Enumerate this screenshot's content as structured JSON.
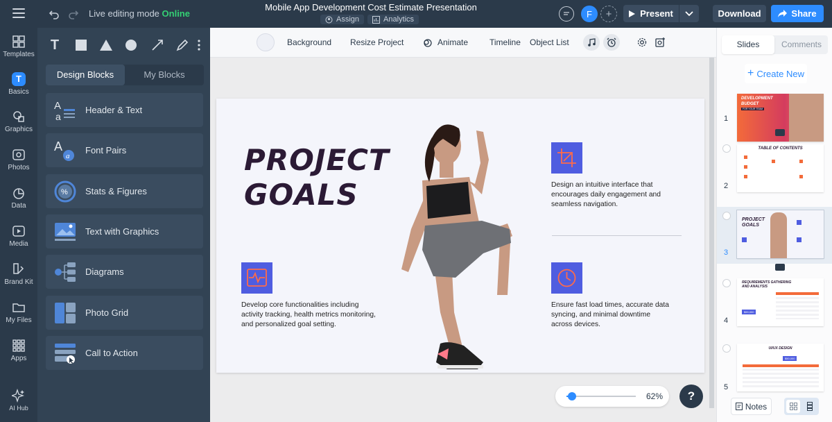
{
  "header": {
    "mode_label": "Live editing mode",
    "mode_status": "Online",
    "doc_title": "Mobile App Development Cost Estimate Presentation",
    "assign_label": "Assign",
    "analytics_label": "Analytics",
    "avatar_initial": "F",
    "present_label": "Present",
    "download_label": "Download",
    "share_label": "Share"
  },
  "rail": {
    "items": [
      {
        "label": "Templates",
        "icon": "templates-icon"
      },
      {
        "label": "Basics",
        "icon": "basics-icon"
      },
      {
        "label": "Graphics",
        "icon": "graphics-icon"
      },
      {
        "label": "Photos",
        "icon": "photos-icon"
      },
      {
        "label": "Data",
        "icon": "data-icon"
      },
      {
        "label": "Media",
        "icon": "media-icon"
      },
      {
        "label": "Brand Kit",
        "icon": "brand-kit-icon"
      },
      {
        "label": "My Files",
        "icon": "folder-icon"
      },
      {
        "label": "Apps",
        "icon": "apps-icon"
      },
      {
        "label": "AI Hub",
        "icon": "ai-sparkle-icon"
      }
    ],
    "active": "Basics"
  },
  "panel": {
    "tabs": [
      "Design Blocks",
      "My Blocks"
    ],
    "blocks": [
      "Header & Text",
      "Font Pairs",
      "Stats & Figures",
      "Text with Graphics",
      "Diagrams",
      "Photo Grid",
      "Call to Action"
    ]
  },
  "toolbar": {
    "background": "Background",
    "resize": "Resize Project",
    "animate": "Animate",
    "timeline": "Timeline",
    "object_list": "Object List"
  },
  "slide": {
    "title_line1": "PROJECT",
    "title_line2": "GOALS",
    "feature1": "Design an intuitive interface that encourages daily engagement and seamless navigation.",
    "feature2": "Develop core functionalities including activity tracking, health metrics monitoring, and personalized goal setting.",
    "feature3": "Ensure fast load times, accurate data syncing, and minimal downtime across devices."
  },
  "zoom": {
    "value": "62%",
    "level": 0.08
  },
  "right_panel": {
    "tabs": [
      "Slides",
      "Comments"
    ],
    "create_label": "Create New",
    "thumbs": [
      {
        "num": "1",
        "title": "DEVELOPMENT BUDGET",
        "sub": "FOR YOUR TEAM"
      },
      {
        "num": "2",
        "title": "TABLE OF CONTENTS"
      },
      {
        "num": "3",
        "title": "PROJECT GOALS"
      },
      {
        "num": "4",
        "title": "REQUIREMENTS GATHERING AND ANALYSIS",
        "badge": "$90,000"
      },
      {
        "num": "5",
        "title": "UI/UX DESIGN",
        "badge": "$50,000"
      }
    ],
    "notes_label": "Notes"
  },
  "colors": {
    "accent": "#2d8cff",
    "online": "#34d074",
    "feature_icon": "#4f5de0",
    "icon_stroke": "#ff6b4a",
    "dark": "#2b3a4a"
  }
}
